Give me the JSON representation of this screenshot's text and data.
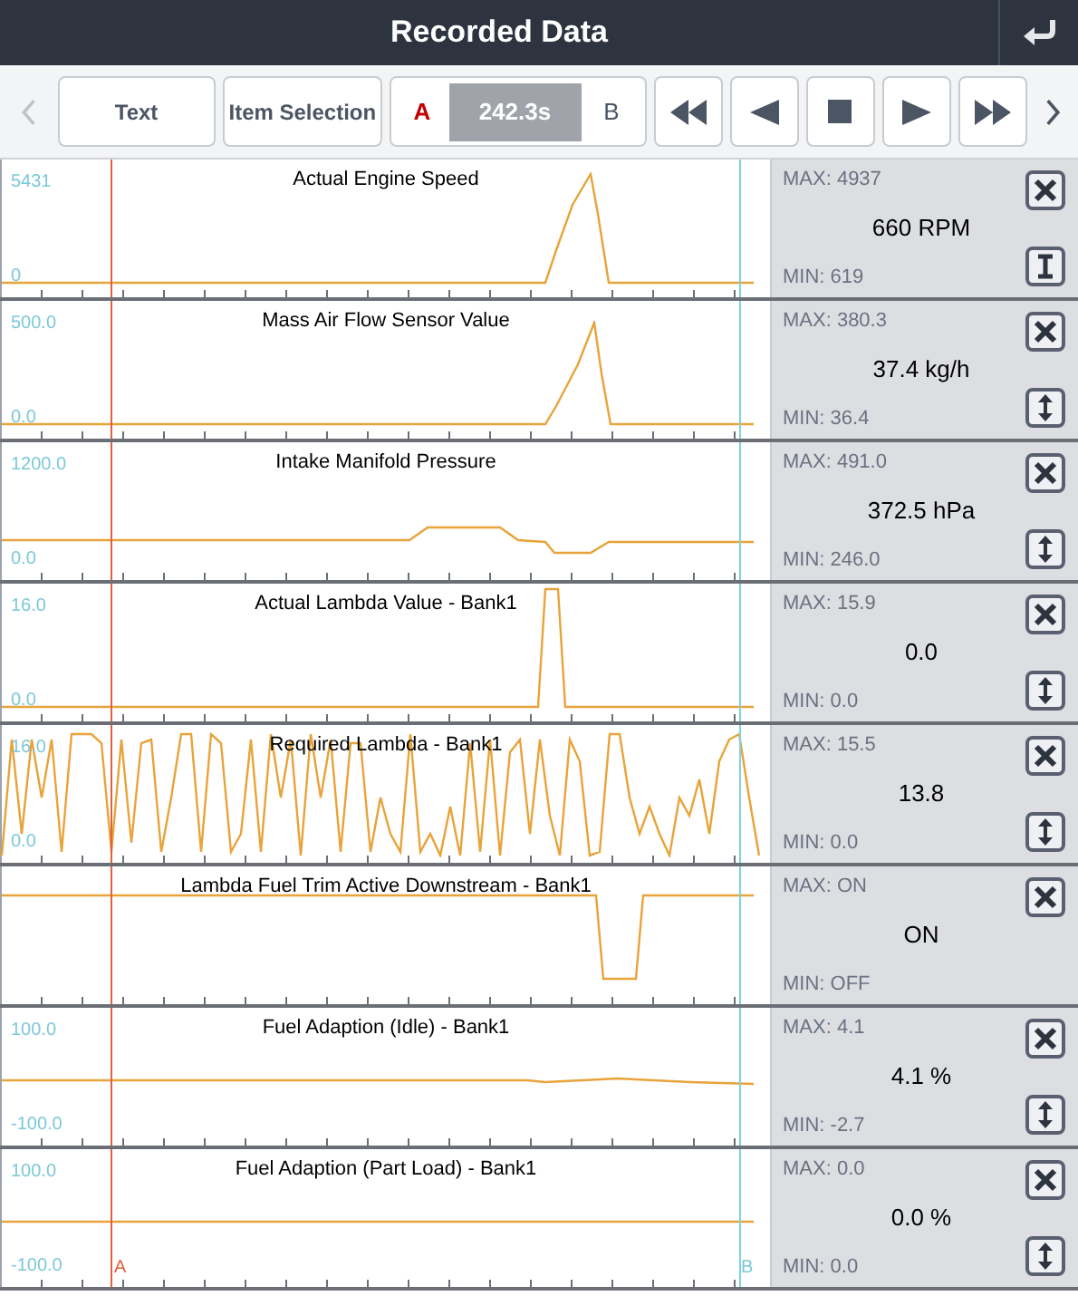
{
  "window": {
    "title": "Recorded Data"
  },
  "toolbar": {
    "buttons": [
      "Text",
      "Item Selection"
    ],
    "cursor_a": "A",
    "time": "242.3s",
    "cursor_b": "B"
  },
  "channels": [
    {
      "name": "Actual Engine Speed",
      "axis_max": "5431",
      "axis_min": "0",
      "max": "MAX: 4937",
      "value": "660 RPM",
      "min": "MIN: 619",
      "kind": "cursor"
    },
    {
      "name": "Mass Air Flow Sensor Value",
      "axis_max": "500.0",
      "axis_min": "0.0",
      "max": "MAX: 380.3",
      "value": "37.4 kg/h",
      "min": "MIN: 36.4",
      "kind": "scaled"
    },
    {
      "name": "Intake Manifold Pressure",
      "axis_max": "1200.0",
      "axis_min": "0.0",
      "max": "MAX: 491.0",
      "value": "372.5 hPa",
      "min": "MIN: 246.0",
      "kind": "scaled"
    },
    {
      "name": "Actual Lambda Value - Bank1",
      "axis_max": "16.0",
      "axis_min": "0.0",
      "max": "MAX: 15.9",
      "value": "0.0",
      "min": "MIN: 0.0",
      "kind": "scaled"
    },
    {
      "name": "Required Lambda - Bank1",
      "axis_max": "16.0",
      "axis_min": "0.0",
      "max": "MAX: 15.5",
      "value": "13.8",
      "min": "MIN: 0.0",
      "kind": "scaled"
    },
    {
      "name": "Lambda Fuel Trim Active Downstream - Bank1",
      "max": "MAX: ON",
      "value": "ON",
      "min": "MIN: OFF",
      "kind": "switch"
    },
    {
      "name": "Fuel Adaption (Idle) - Bank1",
      "axis_max": "100.0",
      "axis_min": "-100.0",
      "max": "MAX: 4.1",
      "value": "4.1 %",
      "min": "MIN: -2.7",
      "kind": "scaled"
    },
    {
      "name": "Fuel Adaption (Part Load) - Bank1",
      "axis_max": "100.0",
      "axis_min": "-100.0",
      "max": "MAX: 0.0",
      "value": "0.0 %",
      "min": "MIN: 0.0",
      "kind": "scaled"
    }
  ],
  "cursors": {
    "a_label": "A",
    "b_label": "B"
  }
}
